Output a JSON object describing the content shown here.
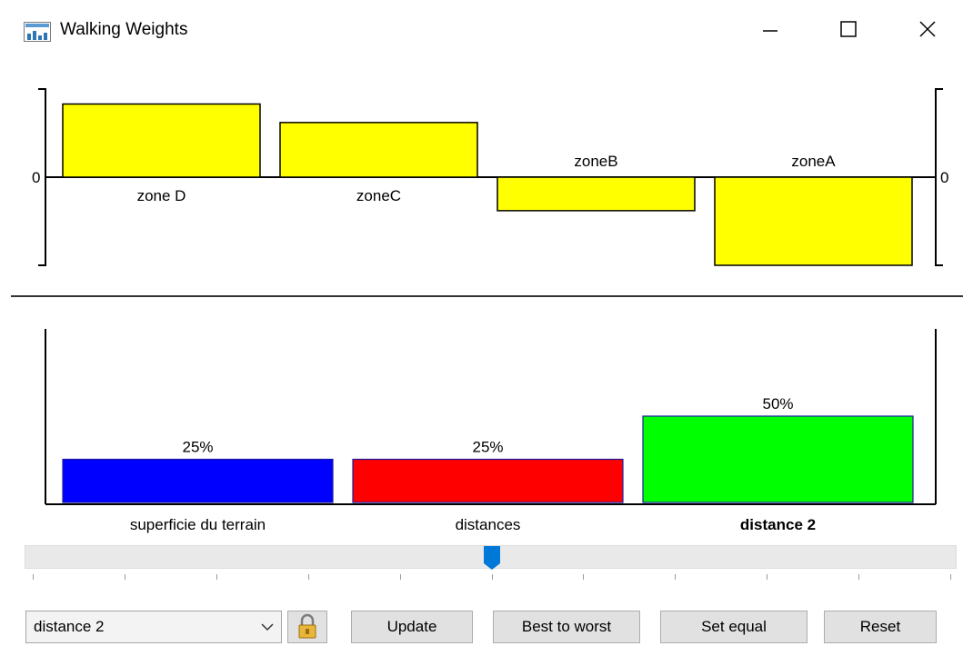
{
  "window": {
    "title": "Walking Weights"
  },
  "top_chart": {
    "type": "bar",
    "zero_label_left": "0",
    "zero_label_right": "0",
    "bar_color": "#ffff00",
    "bars": [
      {
        "label": "zone D",
        "value": 0.83
      },
      {
        "label": "zoneC",
        "value": 0.62
      },
      {
        "label": "zoneB",
        "value": -0.38
      },
      {
        "label": "zoneA",
        "value": -1.0
      }
    ]
  },
  "bottom_chart": {
    "type": "bar",
    "bars": [
      {
        "label": "superficie du terrain",
        "pct_label": "25%",
        "value": 25,
        "color": "#0000ff",
        "bold": false
      },
      {
        "label": "distances",
        "pct_label": "25%",
        "value": 25,
        "color": "#ff0000",
        "bold": false
      },
      {
        "label": "distance 2",
        "pct_label": "50%",
        "value": 50,
        "color": "#00ff00",
        "bold": true
      }
    ]
  },
  "slider": {
    "value": 50,
    "min": 0,
    "max": 100,
    "tick_count": 11,
    "accent": "#0078d7"
  },
  "controls": {
    "criterion_select": "distance 2",
    "lock_icon": "lock-icon",
    "update_label": "Update",
    "best_to_worst_label": "Best to worst",
    "set_equal_label": "Set equal",
    "reset_label": "Reset"
  }
}
